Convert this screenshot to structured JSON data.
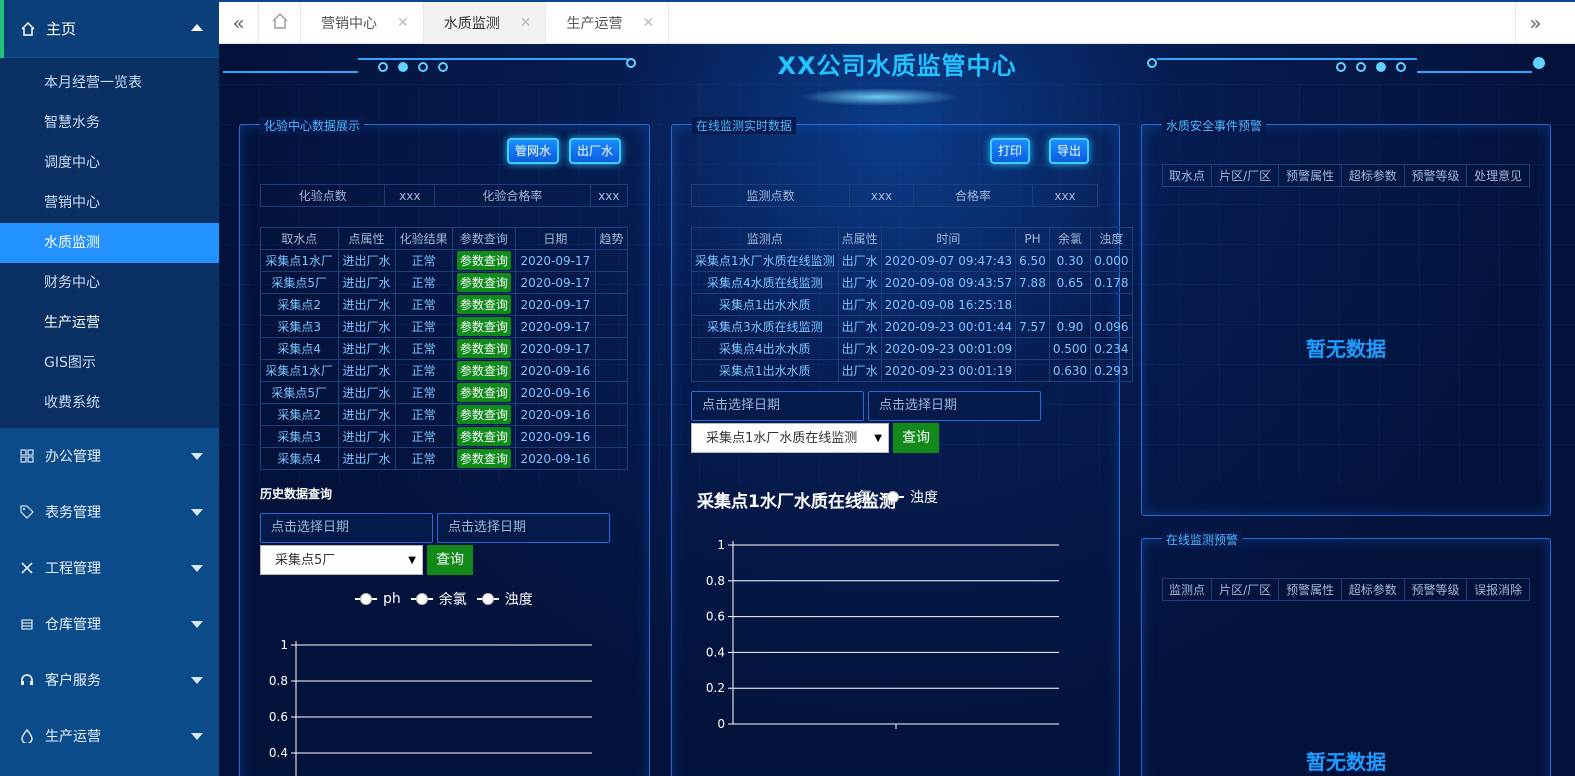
{
  "sidebar": {
    "home": "主页",
    "sub_items": [
      "本月经营一览表",
      "智慧水务",
      "调度中心",
      "营销中心",
      "水质监测",
      "财务中心",
      "生产运营",
      "GIS图示",
      "收费系统"
    ],
    "groups": [
      "办公管理",
      "表务管理",
      "工程管理",
      "仓库管理",
      "客户服务",
      "生产运营"
    ]
  },
  "tabs": [
    "营销中心",
    "水质监测",
    "生产运营"
  ],
  "title": "XX公司水质监管中心",
  "lab_panel": {
    "title": "化验中心数据展示",
    "btn_pipe": "管网水",
    "btn_out": "出厂水",
    "summary": [
      "化验点数",
      "xxx",
      "化验合格率",
      "xxx"
    ],
    "headers": [
      "取水点",
      "点属性",
      "化验结果",
      "参数查询",
      "日期",
      "趋势"
    ],
    "rows": [
      [
        "采集点1水厂",
        "进出厂水",
        "正常",
        "参数查询",
        "2020-09-17",
        ""
      ],
      [
        "采集点5厂",
        "进出厂水",
        "正常",
        "参数查询",
        "2020-09-17",
        ""
      ],
      [
        "采集点2",
        "进出厂水",
        "正常",
        "参数查询",
        "2020-09-17",
        ""
      ],
      [
        "采集点3",
        "进出厂水",
        "正常",
        "参数查询",
        "2020-09-17",
        ""
      ],
      [
        "采集点4",
        "进出厂水",
        "正常",
        "参数查询",
        "2020-09-17",
        ""
      ],
      [
        "采集点1水厂",
        "进出厂水",
        "正常",
        "参数查询",
        "2020-09-16",
        ""
      ],
      [
        "采集点5厂",
        "进出厂水",
        "正常",
        "参数查询",
        "2020-09-16",
        ""
      ],
      [
        "采集点2",
        "进出厂水",
        "正常",
        "参数查询",
        "2020-09-16",
        ""
      ],
      [
        "采集点3",
        "进出厂水",
        "正常",
        "参数查询",
        "2020-09-16",
        ""
      ],
      [
        "采集点4",
        "进出厂水",
        "正常",
        "参数查询",
        "2020-09-16",
        ""
      ]
    ],
    "history_title": "历史数据查询",
    "date_placeholder_1": "点击选择日期",
    "date_placeholder_2": "点击选择日期",
    "select_value": "采集点5厂",
    "query": "查询",
    "legend": [
      "ph",
      "余氯",
      "浊度"
    ]
  },
  "online_panel": {
    "title": "在线监测实时数据",
    "btn_print": "打印",
    "btn_export": "导出",
    "summary": [
      "监测点数",
      "xxx",
      "合格率",
      "xxx"
    ],
    "headers": [
      "监测点",
      "点属性",
      "时间",
      "PH",
      "余氯",
      "浊度"
    ],
    "rows": [
      [
        "采集点1水厂水质在线监测",
        "出厂水",
        "2020-09-07 09:47:43",
        "6.50",
        "0.30",
        "0.000"
      ],
      [
        "采集点4水质在线监测",
        "出厂水",
        "2020-09-08 09:43:57",
        "7.88",
        "0.65",
        "0.178"
      ],
      [
        "采集点1出水水质",
        "出厂水",
        "2020-09-08 16:25:18",
        "",
        "",
        ""
      ],
      [
        "采集点3水质在线监测",
        "出厂水",
        "2020-09-23 00:01:44",
        "7.57",
        "0.90",
        "0.096"
      ],
      [
        "采集点4出水水质",
        "出厂水",
        "2020-09-23 00:01:09",
        "",
        "0.500",
        "0.234"
      ],
      [
        "采集点1出水水质",
        "出厂水",
        "2020-09-23 00:01:19",
        "",
        "0.630",
        "0.293"
      ]
    ],
    "date_placeholder_1": "点击选择日期",
    "date_placeholder_2": "点击选择日期",
    "select_value": "采集点1水厂水质在线监测",
    "query": "查询",
    "chart_title": "采集点1水厂水质在线监测",
    "legend_partial": "氯",
    "legend_turbidity": "浊度"
  },
  "alert_panel": {
    "title": "水质安全事件预警",
    "headers": [
      "取水点",
      "片区/厂区",
      "预警属性",
      "超标参数",
      "预警等级",
      "处理意见"
    ],
    "nodata": "暂无数据"
  },
  "online_alert_panel": {
    "title": "在线监测预警",
    "headers": [
      "监测点",
      "片区/厂区",
      "预警属性",
      "超标参数",
      "预警等级",
      "误报消除"
    ],
    "nodata": "暂无数据"
  },
  "chart_data": [
    {
      "type": "line",
      "series": [
        {
          "name": "ph",
          "values": []
        },
        {
          "name": "余氯",
          "values": []
        },
        {
          "name": "浊度",
          "values": []
        }
      ],
      "yticks": [
        "1",
        "0.8",
        "0.6",
        "0.4"
      ],
      "ylim": [
        0,
        1
      ]
    },
    {
      "type": "line",
      "title": "采集点1水厂水质在线监测",
      "series": [
        {
          "name": "浊度",
          "values": []
        }
      ],
      "yticks": [
        "1",
        "0.8",
        "0.6",
        "0.4",
        "0.2",
        "0"
      ],
      "ylim": [
        0,
        1
      ]
    }
  ]
}
